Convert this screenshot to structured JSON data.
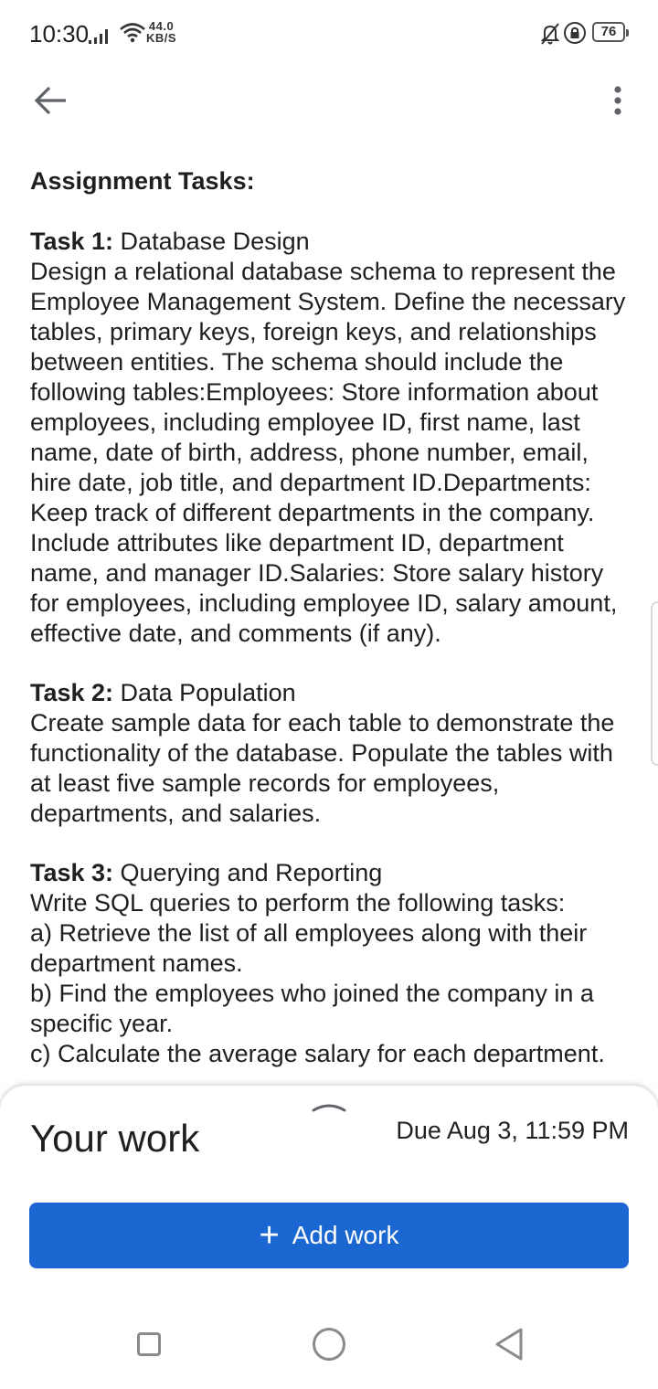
{
  "status_bar": {
    "time": "10:30",
    "net_speed_value": "44.0",
    "net_speed_unit": "KB/S",
    "battery": "76"
  },
  "content": {
    "heading": "Assignment Tasks:",
    "tasks": [
      {
        "label": "Task 1:",
        "title": " Database Design",
        "body": "Design a relational database schema to represent the Employee Management System. Define the necessary tables, primary keys, foreign keys, and relationships between entities. The schema should include the following tables:Employees: Store information about employees, including employee ID, first name, last name, date of birth, address, phone number, email, hire date, job title, and department ID.Departments: Keep track of different departments in the company. Include attributes like department ID, department name, and manager ID.Salaries: Store salary history for employees, including employee ID, salary amount, effective date, and comments (if any)."
      },
      {
        "label": "Task 2:",
        "title": " Data Population",
        "body": "Create sample data for each table to demonstrate the functionality of the database. Populate the tables with at least five sample records for employees, departments, and salaries."
      },
      {
        "label": "Task 3:",
        "title": " Querying and Reporting",
        "body_lines": [
          "Write SQL queries to perform the following tasks:",
          "a) Retrieve the list of all employees along with their department names.",
          "b) Find the employees who joined the company in a specific year.",
          "c) Calculate the average salary for each department."
        ]
      }
    ]
  },
  "bottom_sheet": {
    "title": "Your work",
    "due": "Due Aug 3, 11:59 PM",
    "add_button_icon": "+",
    "add_button_label": "Add work"
  },
  "icons": {
    "back": "arrow-back-icon",
    "more": "more-vert-icon",
    "signal": "signal-icon",
    "wifi": "wifi-icon",
    "bell_off": "bell-off-icon",
    "lock": "lock-icon"
  },
  "colors": {
    "accent": "#1a67d2",
    "text": "#1f1f1f"
  }
}
